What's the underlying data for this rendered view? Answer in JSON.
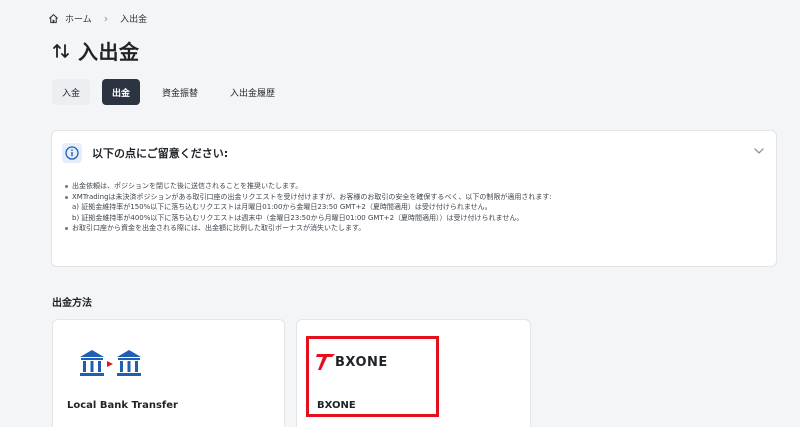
{
  "breadcrumb": {
    "home": "ホーム",
    "current": "入出金"
  },
  "page": {
    "title": "入出金"
  },
  "tabs": [
    {
      "label": "入金"
    },
    {
      "label": "出金"
    },
    {
      "label": "資金振替"
    },
    {
      "label": "入出金履歴"
    }
  ],
  "notice": {
    "title": "以下の点にご留意ください:",
    "items": [
      "出金依頼は、ポジションを閉じた後に送信されることを推奨いたします。",
      "XMTradingは未決済ポジションがある取引口座の出金リクエストを受け付けますが、お客様のお取引の安全を確保するべく、以下の制限が適用されます:",
      "a) 証拠金維持率が150%以下に落ち込むリクエストは月曜日01:00から金曜日23:50 GMT+2（夏時間適用）は受け付けられません。",
      "b) 証拠金維持率が400%以下に落ち込むリクエストは週末中（金曜日23:50から月曜日01:00 GMT+2（夏時間適用））は受け付けられません。",
      "お取引口座から資金を出金される際には、出金額に比例した取引ボーナスが消失いたします。"
    ]
  },
  "withdrawal": {
    "section_title": "出金方法",
    "methods": [
      {
        "label": "Local Bank Transfer",
        "icon": "bank-transfer-icon"
      },
      {
        "label": "BXONE",
        "logo_text": "BXONE"
      }
    ]
  },
  "colors": {
    "accent_dark": "#2b3440",
    "bank_blue": "#1f5fb3",
    "bxone_red": "#e60f1e",
    "highlight": "#e60f1e"
  }
}
